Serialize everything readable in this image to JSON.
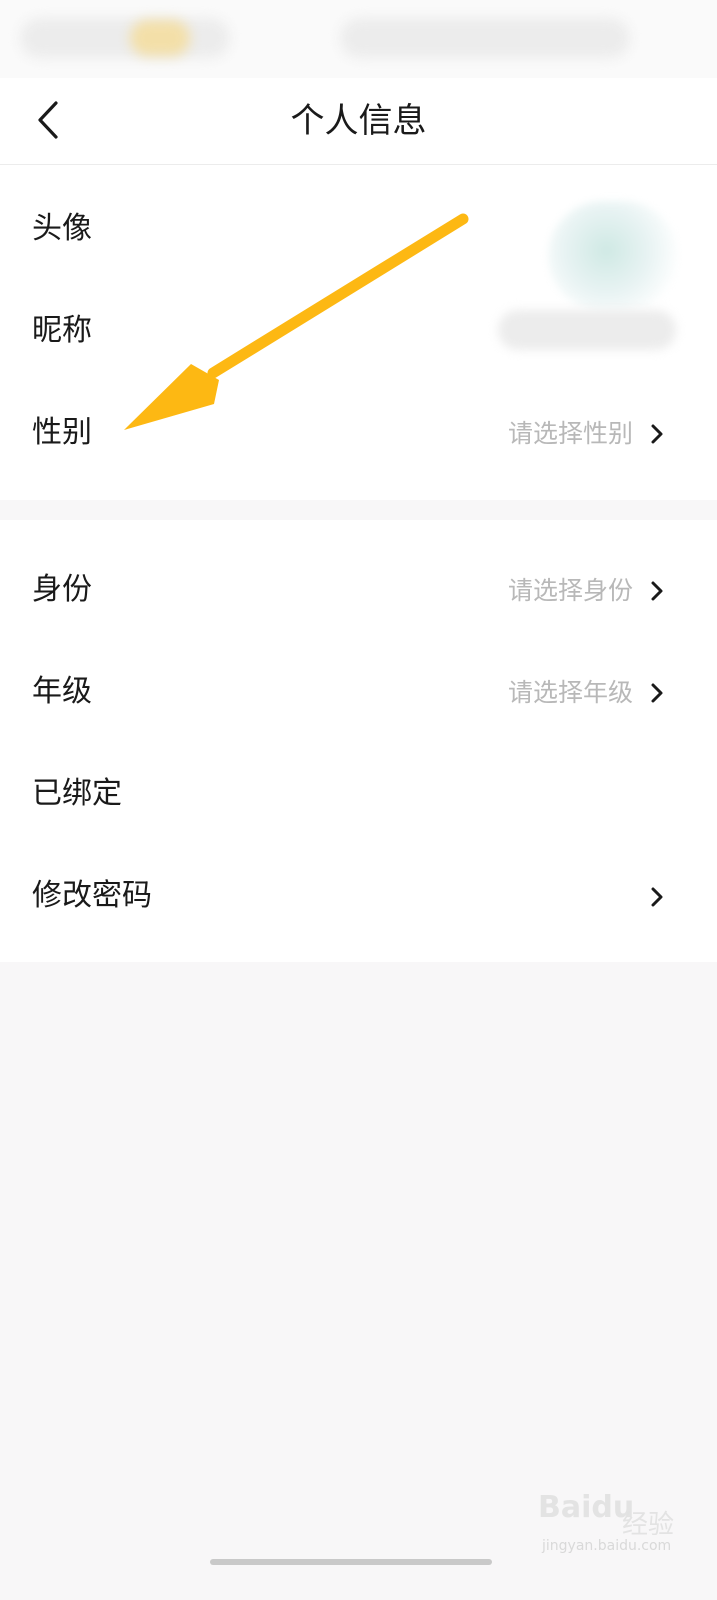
{
  "header": {
    "back_icon": "chevron-left-icon",
    "title": "个人信息"
  },
  "section1": {
    "rows": [
      {
        "label": "头像",
        "value": ""
      },
      {
        "label": "昵称",
        "value": ""
      },
      {
        "label": "性别",
        "value": "请选择性别",
        "icon": "chevron-right-icon"
      }
    ]
  },
  "section2": {
    "rows": [
      {
        "label": "身份",
        "value": "请选择身份",
        "icon": "chevron-right-icon"
      },
      {
        "label": "年级",
        "value": "请选择年级",
        "icon": "chevron-right-icon"
      },
      {
        "label": "已绑定",
        "value": ""
      },
      {
        "label": "修改密码",
        "value": "",
        "icon": "chevron-right-icon"
      }
    ]
  },
  "annotation": {
    "color": "#FDB813",
    "icon": "arrow-annotation-icon"
  },
  "watermark": {
    "brand": "Bai",
    "brand_suffix": "du",
    "jy": "经验",
    "url": "jingyan.baidu.com"
  }
}
